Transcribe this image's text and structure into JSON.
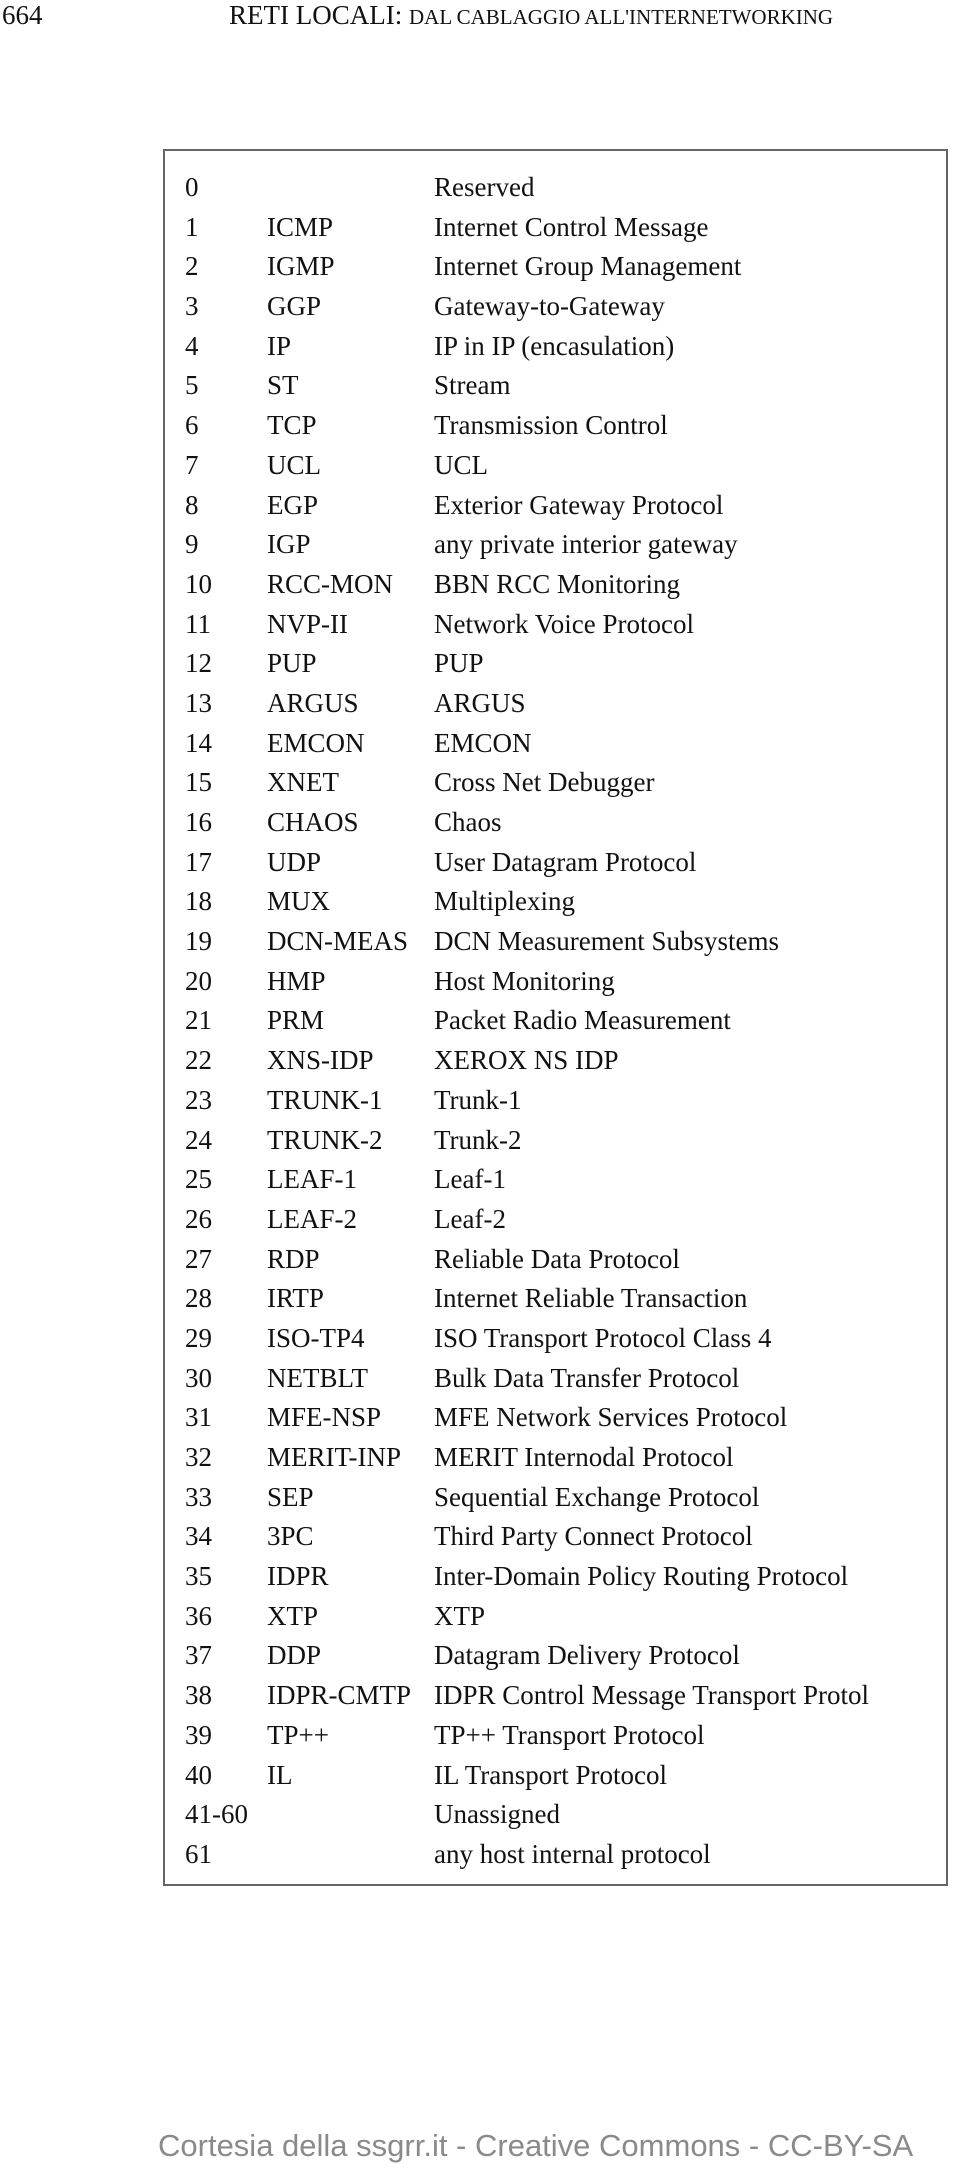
{
  "header": {
    "page_number": "664",
    "title_main": "RETI LOCALI:",
    "title_small_caps": "DAL CABLAGGIO ALL'INTERNETWORKING"
  },
  "protocols": [
    {
      "num": "0",
      "abbr": "",
      "desc": "Reserved"
    },
    {
      "num": "1",
      "abbr": "ICMP",
      "desc": "Internet Control Message"
    },
    {
      "num": "2",
      "abbr": "IGMP",
      "desc": "Internet Group Management"
    },
    {
      "num": "3",
      "abbr": "GGP",
      "desc": "Gateway-to-Gateway"
    },
    {
      "num": "4",
      "abbr": "IP",
      "desc": "IP in IP (encasulation)"
    },
    {
      "num": "5",
      "abbr": "ST",
      "desc": "Stream"
    },
    {
      "num": "6",
      "abbr": "TCP",
      "desc": "Transmission Control"
    },
    {
      "num": "7",
      "abbr": "UCL",
      "desc": "UCL"
    },
    {
      "num": "8",
      "abbr": "EGP",
      "desc": "Exterior Gateway Protocol"
    },
    {
      "num": "9",
      "abbr": "IGP",
      "desc": "any private interior gateway"
    },
    {
      "num": "10",
      "abbr": "RCC-MON",
      "desc": "BBN RCC Monitoring"
    },
    {
      "num": "11",
      "abbr": "NVP-II",
      "desc": "Network Voice Protocol"
    },
    {
      "num": "12",
      "abbr": "PUP",
      "desc": "PUP"
    },
    {
      "num": "13",
      "abbr": "ARGUS",
      "desc": "ARGUS"
    },
    {
      "num": "14",
      "abbr": "EMCON",
      "desc": "EMCON"
    },
    {
      "num": "15",
      "abbr": "XNET",
      "desc": "Cross Net Debugger"
    },
    {
      "num": "16",
      "abbr": "CHAOS",
      "desc": "Chaos"
    },
    {
      "num": "17",
      "abbr": "UDP",
      "desc": "User Datagram Protocol"
    },
    {
      "num": "18",
      "abbr": "MUX",
      "desc": "Multiplexing"
    },
    {
      "num": "19",
      "abbr": "DCN-MEAS",
      "desc": "DCN Measurement Subsystems"
    },
    {
      "num": "20",
      "abbr": "HMP",
      "desc": "Host Monitoring"
    },
    {
      "num": "21",
      "abbr": "PRM",
      "desc": "Packet Radio Measurement"
    },
    {
      "num": "22",
      "abbr": "XNS-IDP",
      "desc": "XEROX NS IDP"
    },
    {
      "num": "23",
      "abbr": "TRUNK-1",
      "desc": "Trunk-1"
    },
    {
      "num": "24",
      "abbr": "TRUNK-2",
      "desc": "Trunk-2"
    },
    {
      "num": "25",
      "abbr": "LEAF-1",
      "desc": "Leaf-1"
    },
    {
      "num": "26",
      "abbr": "LEAF-2",
      "desc": "Leaf-2"
    },
    {
      "num": "27",
      "abbr": "RDP",
      "desc": "Reliable Data Protocol"
    },
    {
      "num": "28",
      "abbr": "IRTP",
      "desc": "Internet Reliable Transaction"
    },
    {
      "num": "29",
      "abbr": "ISO-TP4",
      "desc": "ISO Transport Protocol Class 4"
    },
    {
      "num": "30",
      "abbr": "NETBLT",
      "desc": "Bulk Data Transfer Protocol"
    },
    {
      "num": "31",
      "abbr": "MFE-NSP",
      "desc": "MFE Network Services Protocol"
    },
    {
      "num": "32",
      "abbr": "MERIT-INP",
      "desc": "MERIT Internodal Protocol"
    },
    {
      "num": "33",
      "abbr": "SEP",
      "desc": "Sequential Exchange Protocol"
    },
    {
      "num": "34",
      "abbr": "3PC",
      "desc": "Third Party Connect Protocol"
    },
    {
      "num": "35",
      "abbr": "IDPR",
      "desc": "Inter-Domain Policy Routing Protocol"
    },
    {
      "num": "36",
      "abbr": "XTP",
      "desc": "XTP"
    },
    {
      "num": "37",
      "abbr": "DDP",
      "desc": "Datagram Delivery Protocol"
    },
    {
      "num": "38",
      "abbr": "IDPR-CMTP",
      "desc": "IDPR Control Message Transport Protol"
    },
    {
      "num": "39",
      "abbr": "TP++",
      "desc": "TP++ Transport Protocol"
    },
    {
      "num": "40",
      "abbr": "IL",
      "desc": "IL Transport Protocol"
    },
    {
      "num": "41-60",
      "abbr": "",
      "desc": "Unassigned"
    },
    {
      "num": "61",
      "abbr": "",
      "desc": "any host internal protocol"
    }
  ],
  "footer": {
    "text": "Cortesia della ssgrr.it - Creative Commons - CC-BY-SA"
  }
}
